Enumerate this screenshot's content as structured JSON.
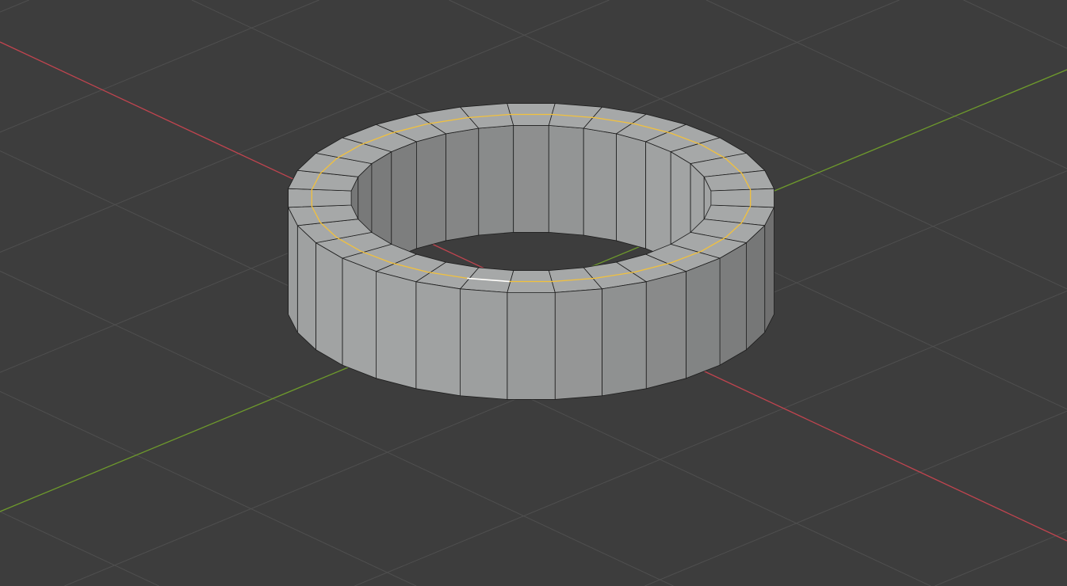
{
  "viewport": {
    "view": "3D Viewport",
    "shading": "solid",
    "object": "ring",
    "selection": "edge-loop",
    "segments": 32
  },
  "colors": {
    "background": "#3d3d3d",
    "grid": "#4f4f4f",
    "x_axis": "#c0444f",
    "y_axis": "#6e9a2c",
    "mesh_light": "#a2a4a4",
    "mesh_dark": "#4a4a4a",
    "wire": "#1c1c1c",
    "selected_edge": "#f2c13c",
    "active_edge": "#ffffff"
  }
}
